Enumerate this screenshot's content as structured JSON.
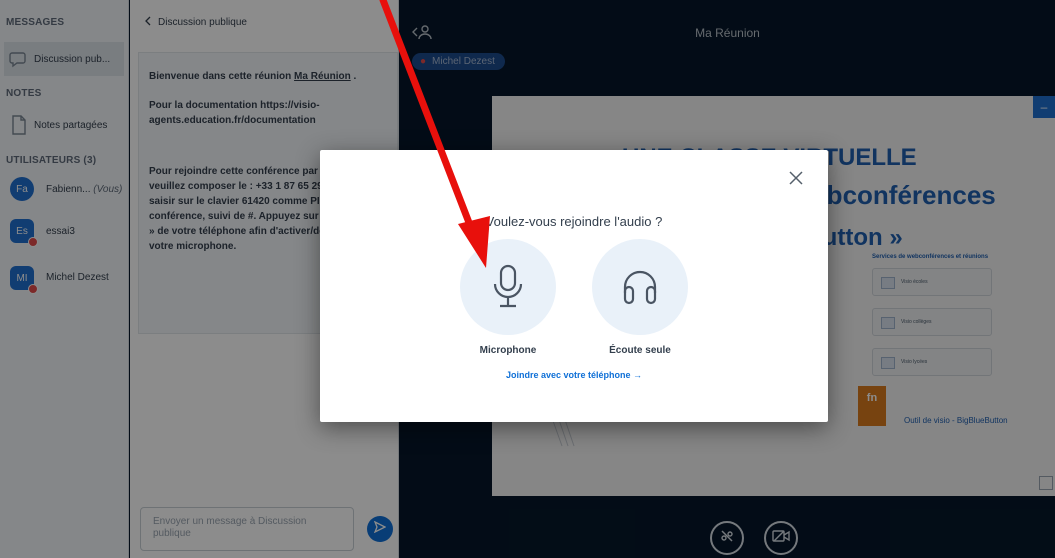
{
  "sidebar": {
    "messages_heading": "MESSAGES",
    "public_chat_label": "Discussion pub...",
    "notes_heading": "NOTES",
    "shared_notes_label": "Notes partagées",
    "users_heading": "UTILISATEURS (3)",
    "users": [
      {
        "initials": "Fa",
        "name": "Fabienn...",
        "you": "(Vous)",
        "color": "#1f6fd0",
        "muted": false
      },
      {
        "initials": "Es",
        "name": "essai3",
        "you": "",
        "color": "#1f6fd0",
        "muted": true
      },
      {
        "initials": "MI",
        "name": "Michel Dezest",
        "you": "",
        "color": "#1f6fd0",
        "muted": true
      }
    ]
  },
  "chat": {
    "back_label": "Discussion publique",
    "welcome_prefix": "Bienvenue dans cette réunion ",
    "welcome_link": "Ma Réunion",
    "welcome_suffix": " .",
    "doc_text": "Pour la documentation https://visio-agents.education.fr/documentation",
    "phone_text": "Pour rejoindre cette conférence par téléphone, veuillez composer le : +33 1 87 65 29 04 puis saisir sur le clavier 61420 comme PIN de la conférence, suivi de #. Appuyez sur la touche « 0 » de votre téléphone afin d'activer/désactiver votre microphone.",
    "input_placeholder": "Envoyer un message à Discussion publique"
  },
  "main": {
    "meeting_title": "Ma Réunion",
    "presenter_name": "Michel Dezest",
    "slide": {
      "title_line1": "UNE CLASSE VIRTUELLE",
      "title_line2": "webconférences",
      "title_line3": "eButton »",
      "services_heading": "Services de webconférences et réunions",
      "services": [
        "Visio écoles",
        "Visio collèges",
        "Visio lycées"
      ],
      "footer_text": "Outil de visio - BigBlueButton"
    }
  },
  "modal": {
    "title": "Voulez-vous rejoindre l'audio ?",
    "microphone_label": "Microphone",
    "listen_only_label": "Écoute seule",
    "phone_link": "Joindre avec votre téléphone →"
  },
  "colors": {
    "accent": "#0f70d7",
    "annotation_arrow": "#e8100c",
    "dark_bg": "#06172a"
  }
}
